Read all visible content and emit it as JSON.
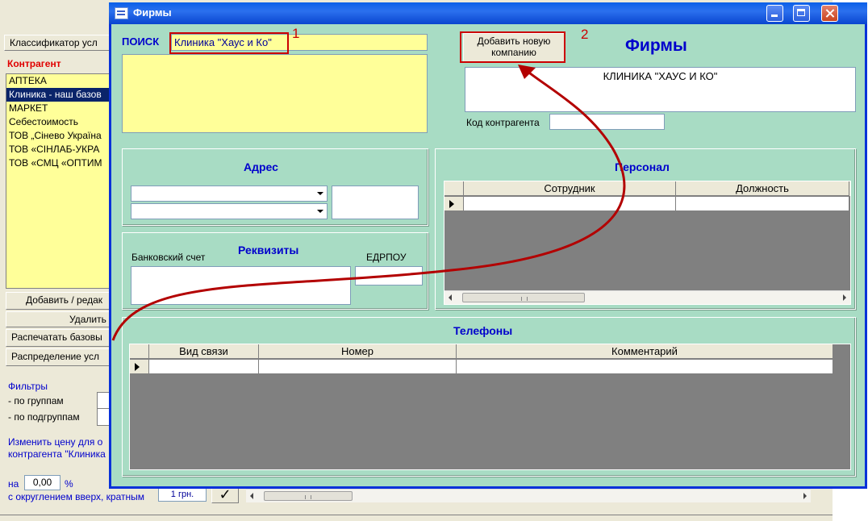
{
  "background_window": {
    "classifier_button": "Классификатор усл",
    "counterparty_label": "Контрагент",
    "counterparty_list": [
      "АПТЕКА",
      "Клиника - наш базов",
      "МАРКЕТ",
      "Себестоимость",
      "ТОВ „Сінево Україна",
      "ТОВ «СІНЛАБ-УКРА",
      "ТОВ «СМЦ «ОПТИМ"
    ],
    "selected_index": 1,
    "add_edit_button": "Добавить / редак",
    "delete_button": "Удалить",
    "print_button": "Распечатать базовы",
    "distribution_button": "Распределение усл",
    "filters_label": "Фильтры",
    "by_groups_label": "- по группам",
    "by_subgroups_label": "- по подгруппам",
    "change_price_line1": "Изменить цену для о",
    "change_price_line2": "контрагента \"Клиника",
    "on_label": "на",
    "price_value": "0,00",
    "percent_label": "%",
    "rounding_label": "с округлением вверх, кратным",
    "rounding_value": "1 грн.",
    "checkmark": "✓"
  },
  "window": {
    "title": "Фирмы",
    "search_label": "ПОИСК",
    "search_value": "Клиника \"Хаус и Ко\"",
    "add_company_button": "Добавить новую компанию",
    "heading": "Фирмы",
    "company_name": "КЛИНИКА \"ХАУС И КО\"",
    "counterparty_code_label": "Код контрагента",
    "counterparty_code_value": "",
    "address_title": "Адрес",
    "personnel_title": "Персонал",
    "personnel_columns": [
      "Сотрудник",
      "Должность"
    ],
    "details_title": "Реквизиты",
    "bank_account_label": "Банковский счет",
    "edrpou_label": "ЕДРПОУ",
    "phones_title": "Телефоны",
    "phone_columns": [
      "Вид связи",
      "Номер",
      "Комментарий"
    ],
    "scroll_grip": "III"
  },
  "annotations": {
    "marker1": "1",
    "marker2": "2",
    "color": "#cc0000"
  }
}
